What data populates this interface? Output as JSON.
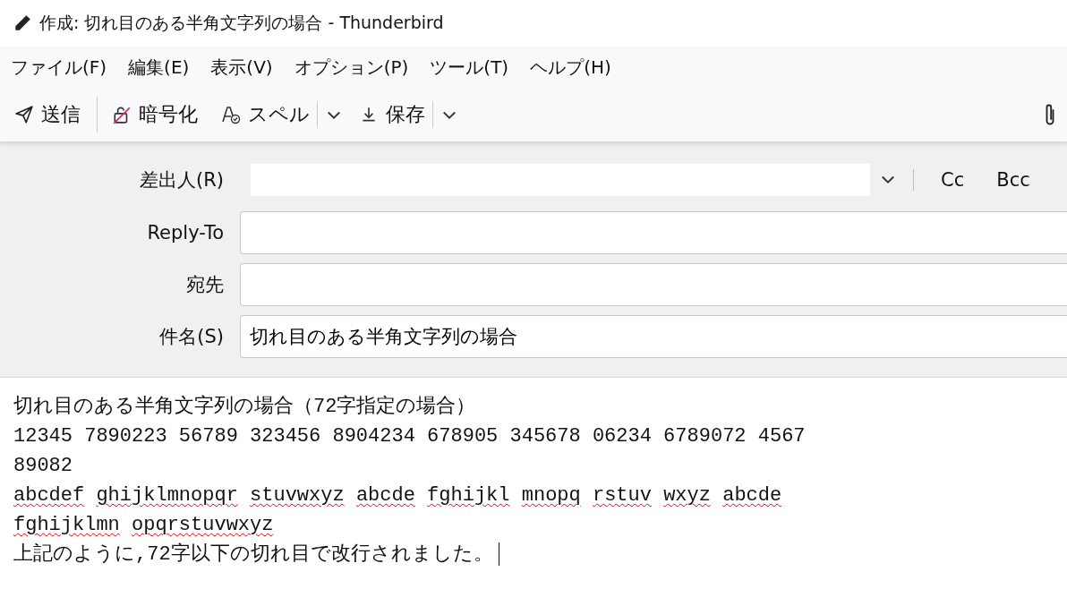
{
  "window": {
    "title": "作成: 切れ目のある半角文字列の場合 - Thunderbird"
  },
  "menu": [
    "ファイル(F)",
    "編集(E)",
    "表示(V)",
    "オプション(P)",
    "ツール(T)",
    "ヘルプ(H)"
  ],
  "toolbar": [
    {
      "kind": "send",
      "label": "送信"
    },
    {
      "kind": "separator"
    },
    {
      "kind": "encrypt",
      "label": "暗号化"
    },
    {
      "kind": "spell",
      "label": "スペル"
    },
    {
      "kind": "dropdown"
    },
    {
      "kind": "save",
      "label": "保存"
    },
    {
      "kind": "dropdown"
    }
  ],
  "header": {
    "from_label": "差出人(R)",
    "cc": "Cc",
    "bcc": "Bcc",
    "fields": [
      {
        "label": "Reply-To"
      },
      {
        "label": "宛先"
      },
      {
        "label": "件名(S)",
        "value": "切れ目のある半角文字列の場合"
      }
    ]
  },
  "body": [
    {
      "text": "切れ目のある半角文字列の場合（72字指定の場合）",
      "misspelled": false
    },
    {
      "text": "12345 7890223 56789 323456 8904234 678905 345678 06234 6789072 4567",
      "misspelled": false
    },
    {
      "text": "89082",
      "misspelled": false
    },
    {
      "text": "abcdef ghijklmnopqr stuvwxyz abcde fghijkl mnopq rstuv wxyz abcde",
      "misspelled": true
    },
    {
      "text": "fghijklmn opqrstuvwxyz",
      "misspelled": true
    },
    {
      "text": "上記のように,72字以下の切れ目で改行されました。",
      "misspelled": false,
      "caret": true
    }
  ]
}
